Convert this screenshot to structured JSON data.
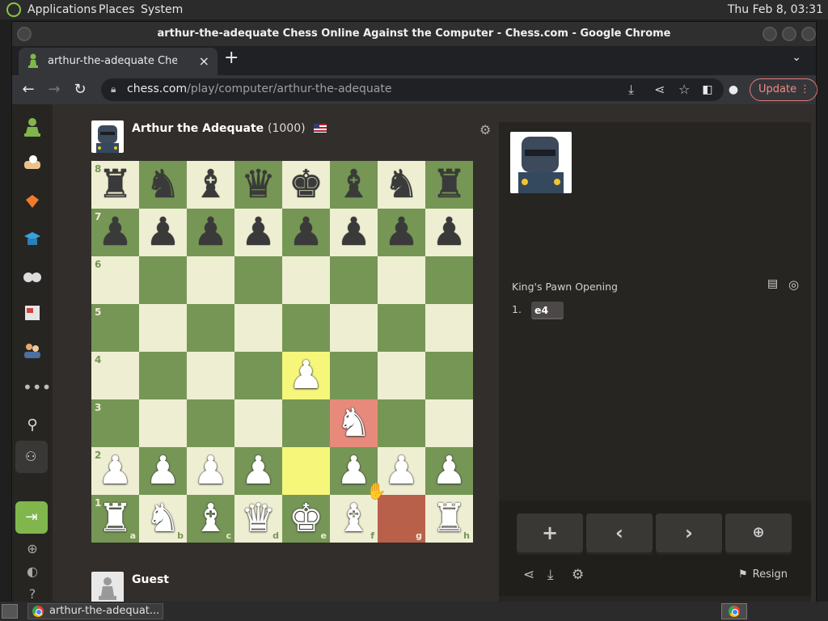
{
  "desktop": {
    "menus": [
      "Applications",
      "Places",
      "System"
    ],
    "clock": "Thu Feb  8, 03:31"
  },
  "window": {
    "title": "arthur-the-adequate Chess Online Against the Computer - Chess.com - Google Chrome"
  },
  "browser": {
    "tab_title": "arthur-the-adequate Chess Online Against the Computer - Chess.com",
    "tab_close": "×",
    "new_tab": "+",
    "url_host": "chess.com",
    "url_path": "/play/computer/arthur-the-adequate",
    "update_label": "Update"
  },
  "opponent": {
    "name": "Arthur the Adequate",
    "rating": "(1000)"
  },
  "player": {
    "name": "Guest"
  },
  "board": {
    "ranks": [
      "8",
      "7",
      "6",
      "5",
      "4",
      "3",
      "2",
      "1"
    ],
    "files": [
      "a",
      "b",
      "c",
      "d",
      "e",
      "f",
      "g",
      "h"
    ],
    "position": [
      [
        "r",
        "n",
        "b",
        "q",
        "k",
        "b",
        "n",
        "r"
      ],
      [
        "p",
        "p",
        "p",
        "p",
        "p",
        "p",
        "p",
        "p"
      ],
      [
        "",
        "",
        "",
        "",
        "",
        "",
        "",
        ""
      ],
      [
        "",
        "",
        "",
        "",
        "",
        "",
        "",
        ""
      ],
      [
        "",
        "",
        "",
        "",
        "P",
        "",
        "",
        ""
      ],
      [
        "",
        "",
        "",
        "",
        "",
        "N",
        "",
        ""
      ],
      [
        "P",
        "P",
        "P",
        "P",
        "",
        "P",
        "P",
        "P"
      ],
      [
        "R",
        "N",
        "B",
        "Q",
        "K",
        "B",
        "",
        "R"
      ]
    ],
    "highlights": {
      "e4": "yellow",
      "e2": "yellow",
      "f3": "red",
      "g1": "dark-red"
    }
  },
  "panel": {
    "opening": "King's Pawn Opening",
    "moves": [
      {
        "number": "1.",
        "white": "e4"
      }
    ],
    "resign_label": "Resign"
  },
  "taskbar": {
    "window_label": "arthur-the-adequat..."
  }
}
